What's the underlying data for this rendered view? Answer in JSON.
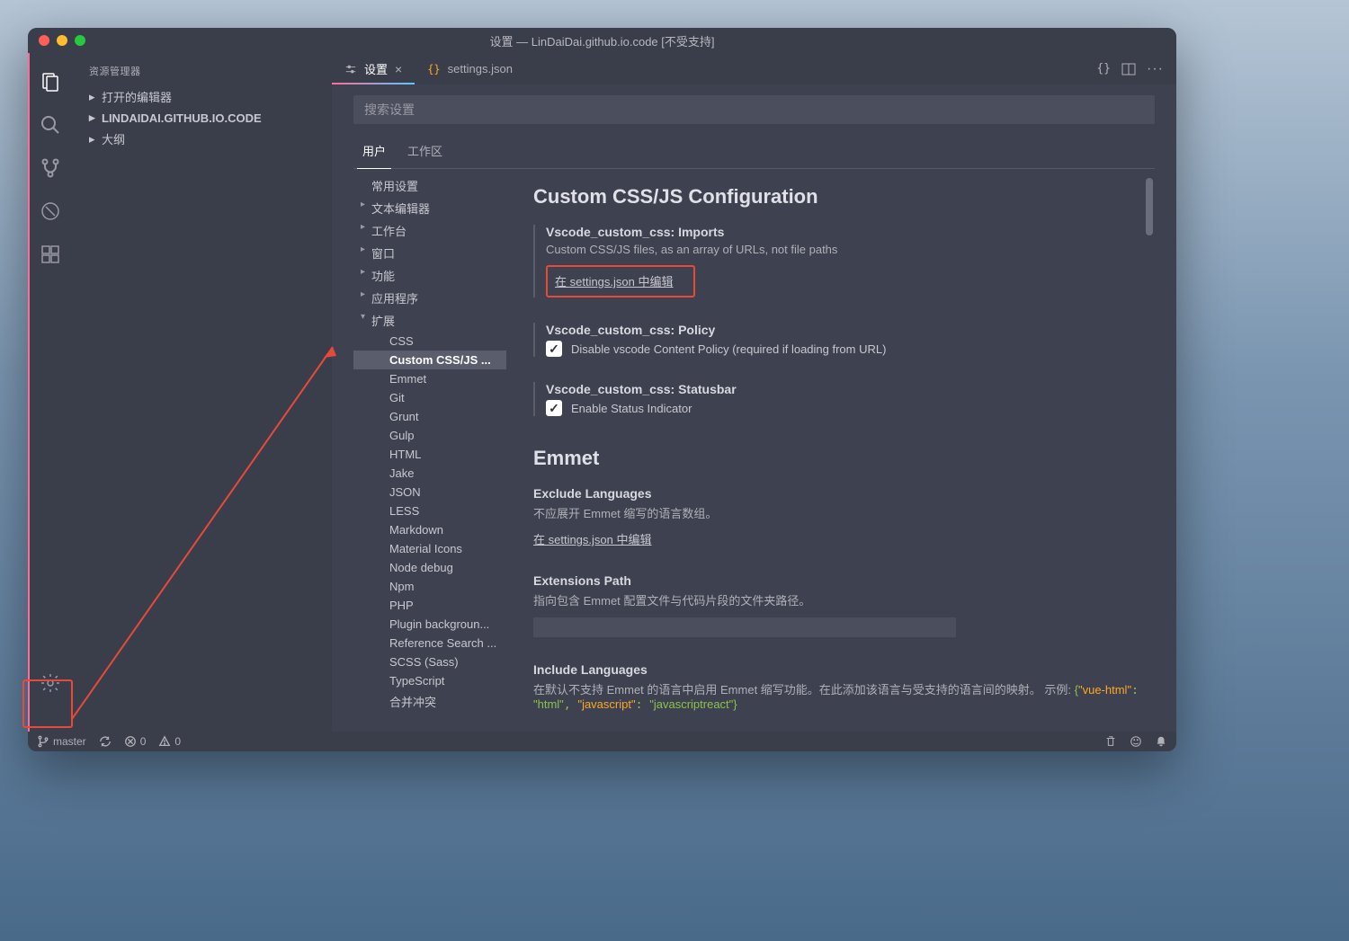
{
  "window_title": "设置 — LinDaiDai.github.io.code [不受支持]",
  "sidebar": {
    "title": "资源管理器",
    "sections": [
      {
        "label": "打开的编辑器"
      },
      {
        "label": "LINDAIDAI.GITHUB.IO.CODE",
        "bold": true
      },
      {
        "label": "大纲"
      }
    ]
  },
  "tabs": [
    {
      "label": "设置",
      "active": true,
      "icon": "settings"
    },
    {
      "label": "settings.json",
      "active": false,
      "icon": "json"
    }
  ],
  "search_placeholder": "搜索设置",
  "scope_tabs": [
    {
      "label": "用户",
      "active": true
    },
    {
      "label": "工作区",
      "active": false
    }
  ],
  "toc": [
    {
      "label": "常用设置",
      "level": 1
    },
    {
      "label": "文本编辑器",
      "level": 1,
      "expandable": true
    },
    {
      "label": "工作台",
      "level": 1,
      "expandable": true
    },
    {
      "label": "窗口",
      "level": 1,
      "expandable": true
    },
    {
      "label": "功能",
      "level": 1,
      "expandable": true
    },
    {
      "label": "应用程序",
      "level": 1,
      "expandable": true
    },
    {
      "label": "扩展",
      "level": 1,
      "expandable": true,
      "expanded": true
    },
    {
      "label": "CSS",
      "level": 3
    },
    {
      "label": "Custom CSS/JS ...",
      "level": 3,
      "selected": true
    },
    {
      "label": "Emmet",
      "level": 3
    },
    {
      "label": "Git",
      "level": 3
    },
    {
      "label": "Grunt",
      "level": 3
    },
    {
      "label": "Gulp",
      "level": 3
    },
    {
      "label": "HTML",
      "level": 3
    },
    {
      "label": "Jake",
      "level": 3
    },
    {
      "label": "JSON",
      "level": 3
    },
    {
      "label": "LESS",
      "level": 3
    },
    {
      "label": "Markdown",
      "level": 3
    },
    {
      "label": "Material Icons",
      "level": 3
    },
    {
      "label": "Node debug",
      "level": 3
    },
    {
      "label": "Npm",
      "level": 3
    },
    {
      "label": "PHP",
      "level": 3
    },
    {
      "label": "Plugin backgroun...",
      "level": 3
    },
    {
      "label": "Reference Search ...",
      "level": 3
    },
    {
      "label": "SCSS (Sass)",
      "level": 3
    },
    {
      "label": "TypeScript",
      "level": 3
    },
    {
      "label": "合并冲突",
      "level": 3
    }
  ],
  "sections": {
    "custom_css": {
      "heading": "Custom CSS/JS Configuration",
      "imports": {
        "title": "Vscode_custom_css: Imports",
        "desc": "Custom CSS/JS files, as an array of URLs, not file paths",
        "link": "在 settings.json 中编辑"
      },
      "policy": {
        "title": "Vscode_custom_css: Policy",
        "label": "Disable vscode Content Policy (required if loading from URL)"
      },
      "statusbar": {
        "title": "Vscode_custom_css: Statusbar",
        "label": "Enable Status Indicator"
      }
    },
    "emmet": {
      "heading": "Emmet",
      "exclude": {
        "title": "Exclude Languages",
        "desc": "不应展开 Emmet 缩写的语言数组。",
        "link": "在 settings.json 中编辑"
      },
      "ext_path": {
        "title": "Extensions Path",
        "desc": "指向包含 Emmet 配置文件与代码片段的文件夹路径。"
      },
      "include": {
        "title": "Include Languages",
        "desc_pre": "在默认不支持 Emmet 的语言中启用 Emmet 缩写功能。在此添加该语言与受支持的语言间的映射。 示例: ",
        "code": "{\"vue-html\": \"html\", \"javascript\": \"javascriptreact\"}"
      }
    }
  },
  "statusbar": {
    "branch": "master",
    "errors": "0",
    "warnings": "0"
  }
}
